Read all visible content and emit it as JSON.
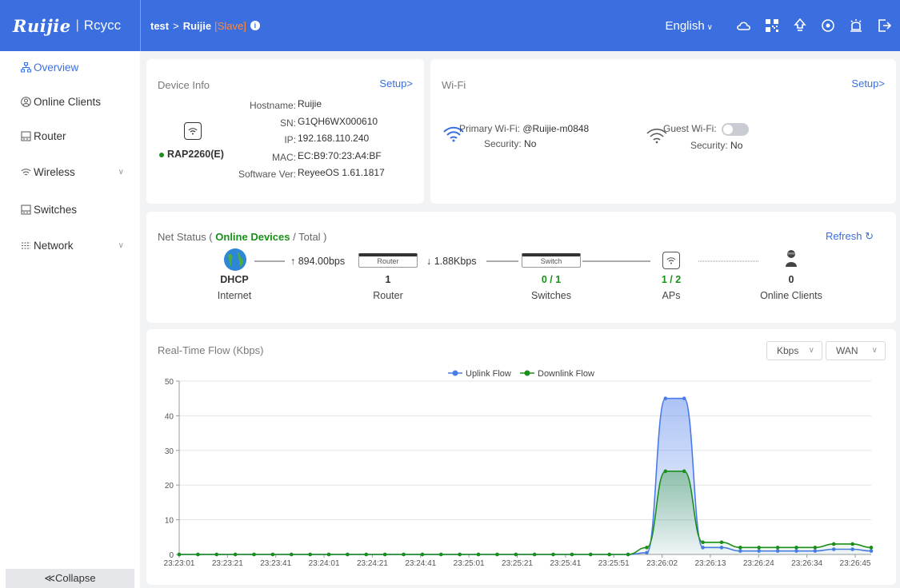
{
  "header": {
    "brand": "Ruijie",
    "brand_sep": "|",
    "sub_brand": "Rcycc",
    "crumb_root": "test",
    "crumb_arrow": ">",
    "crumb_device": "Ruijie",
    "crumb_role": "[Slave]",
    "info_glyph": "i",
    "language": "English",
    "icons": [
      "cloud-icon",
      "qr-code-icon",
      "rocket-icon",
      "network-icon",
      "alarm-icon",
      "logout-icon"
    ],
    "accent": "#3b6fe0"
  },
  "sidebar": {
    "items": [
      {
        "label": "Overview",
        "icon": "topology-icon",
        "active": true
      },
      {
        "label": "Online Clients",
        "icon": "client-icon"
      },
      {
        "label": "Router",
        "icon": "router-icon"
      },
      {
        "label": "Wireless",
        "icon": "wifi-icon",
        "expandable": true
      },
      {
        "label": "Switches",
        "icon": "switch-icon"
      },
      {
        "label": "Network",
        "icon": "network-icon",
        "expandable": true
      }
    ],
    "collapse_label": "≪Collapse"
  },
  "device_info": {
    "title": "Device Info",
    "setup": "Setup>",
    "model": "RAP2260(E)",
    "status_color": "#1a8f1a",
    "fields": [
      {
        "key": "Hostname:",
        "value": "Ruijie"
      },
      {
        "key": "SN:",
        "value": "G1QH6WX000610"
      },
      {
        "key": "IP:",
        "value": "192.168.110.240"
      },
      {
        "key": "MAC:",
        "value": "EC:B9:70:23:A4:BF"
      },
      {
        "key": "Software Ver:",
        "value": "ReyeeOS 1.61.1817"
      }
    ]
  },
  "wifi": {
    "title": "Wi-Fi",
    "setup": "Setup>",
    "primary_key": "Primary Wi-Fi:",
    "primary_value": "@Ruijie-m0848",
    "primary_security_key": "Security:",
    "primary_security_value": "No",
    "guest_key": "Guest Wi-Fi:",
    "guest_enabled": false,
    "guest_security_key": "Security:",
    "guest_security_value": "No"
  },
  "net_status": {
    "title_prefix": "Net Status (",
    "title_online": "Online Devices",
    "title_suffix": "/ Total )",
    "refresh": "Refresh",
    "uplink_rate": "↑ 894.00bps",
    "downlink_rate": "↓ 1.88Kbps",
    "router_box": "Router",
    "switch_box": "Switch",
    "nodes": [
      {
        "value": "DHCP",
        "label": "Internet"
      },
      {
        "value": "1",
        "label": "Router"
      },
      {
        "value": "0 / 1",
        "label": "Switches"
      },
      {
        "value": "1 / 2",
        "label": "APs"
      },
      {
        "value": "0",
        "label": "Online Clients"
      }
    ]
  },
  "flow": {
    "title": "Real-Time Flow (Kbps)",
    "unit_select": "Kbps",
    "iface_select": "WAN"
  },
  "chart_data": {
    "type": "line",
    "legend": [
      "Uplink Flow",
      "Downlink Flow"
    ],
    "legend_position": "top-center",
    "ylim": [
      0,
      50
    ],
    "yticks": [
      0,
      10,
      20,
      30,
      40,
      50
    ],
    "xtick_labels": [
      "23:23:01",
      "23:23:21",
      "23:23:41",
      "23:24:01",
      "23:24:21",
      "23:24:41",
      "23:25:01",
      "23:25:21",
      "23:25:41",
      "23:25:51",
      "23:26:02",
      "23:26:13",
      "23:26:24",
      "23:26:34",
      "23:26:45"
    ],
    "x_count": 30,
    "series": [
      {
        "name": "Uplink Flow",
        "color": "#4a7bea",
        "values": [
          0,
          0,
          0,
          0,
          0,
          0,
          0,
          0,
          0,
          0,
          0,
          0,
          0,
          0,
          0,
          0,
          0,
          0,
          0,
          0,
          0,
          0,
          0,
          0,
          0,
          0.5,
          45,
          45,
          2,
          2,
          1,
          1,
          1,
          1,
          1,
          1.5,
          1.5,
          1
        ]
      },
      {
        "name": "Downlink Flow",
        "color": "#1a8f1a",
        "values": [
          0,
          0,
          0,
          0,
          0,
          0,
          0,
          0,
          0,
          0,
          0,
          0,
          0,
          0,
          0,
          0,
          0,
          0,
          0,
          0,
          0,
          0,
          0,
          0,
          0,
          2,
          24,
          24,
          3.5,
          3.5,
          2,
          2,
          2,
          2,
          2,
          3,
          3,
          2
        ]
      }
    ],
    "grid": true
  }
}
